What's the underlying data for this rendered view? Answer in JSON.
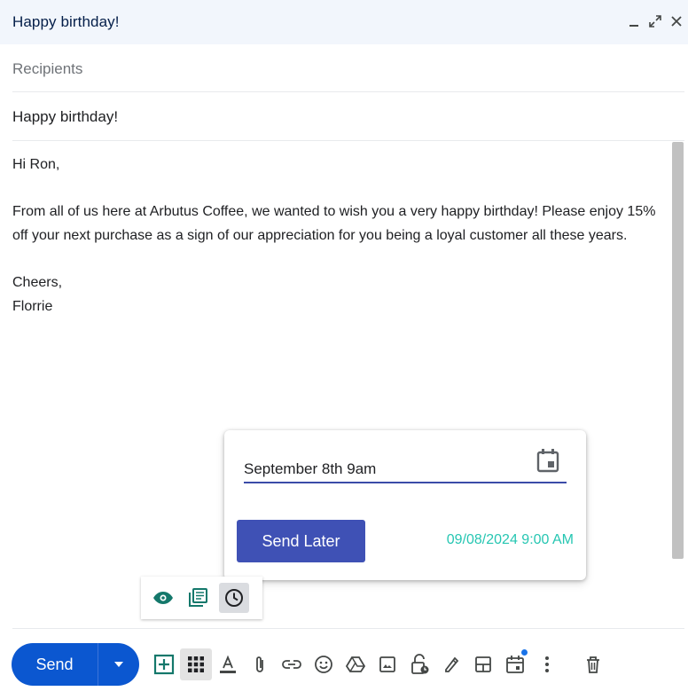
{
  "window": {
    "title": "Happy birthday!",
    "controls": {
      "minimize": "_",
      "maximize": "⤢",
      "close": "✕"
    }
  },
  "compose": {
    "recipients_placeholder": "Recipients",
    "subject": "Happy birthday!",
    "body": {
      "greeting": "Hi Ron,",
      "paragraph": "From all of us here at Arbutus Coffee, we wanted to wish you a very happy birthday! Please enjoy 15% off your next purchase as a sign of our appreciation for you being a loyal customer all these years.",
      "signoff": "Cheers,",
      "name": "Florrie"
    }
  },
  "schedule_popup": {
    "date_input_value": "September 8th 9am",
    "calendar_icon": "calendar-icon",
    "send_later_label": "Send Later",
    "resolved_time": "09/08/2024 9:00 AM"
  },
  "mini_toolbar": {
    "items": [
      {
        "icon": "eye-icon"
      },
      {
        "icon": "template-icon"
      },
      {
        "icon": "clock-icon",
        "active": true
      }
    ]
  },
  "bottom_toolbar": {
    "send_label": "Send",
    "send_options_icon": "caret-down-icon",
    "icons": [
      "add-box-icon",
      "apps-grid-icon",
      "text-format-icon",
      "attach-icon",
      "link-icon",
      "emoji-icon",
      "drive-icon",
      "photo-icon",
      "confidential-lock-icon",
      "signature-pen-icon",
      "layout-icon",
      "calendar-event-icon",
      "more-vert-icon",
      "trash-icon"
    ]
  },
  "colors": {
    "header_bg": "#f2f6fc",
    "send_blue": "#0b57d0",
    "send_later_bg": "#3f51b5",
    "resolved_time_teal": "#26c6b2",
    "notification_dot": "#1a73e8"
  }
}
